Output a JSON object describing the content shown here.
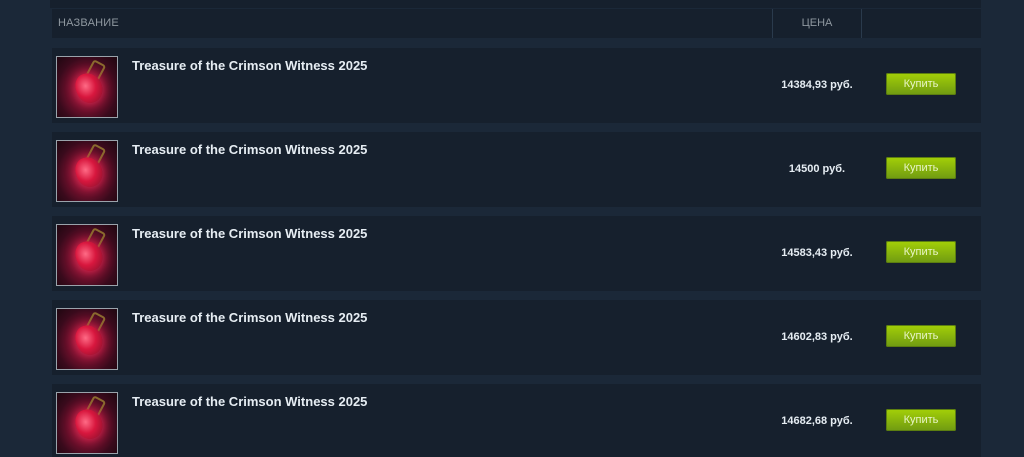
{
  "table": {
    "header": {
      "name_label": "НАЗВАНИЕ",
      "price_label": "ЦЕНА"
    },
    "rows": [
      {
        "name": "Treasure of the Crimson Witness 2025",
        "price": "14384,93 руб.",
        "buy_label": "Купить"
      },
      {
        "name": "Treasure of the Crimson Witness 2025",
        "price": "14500 руб.",
        "buy_label": "Купить"
      },
      {
        "name": "Treasure of the Crimson Witness 2025",
        "price": "14583,43 руб.",
        "buy_label": "Купить"
      },
      {
        "name": "Treasure of the Crimson Witness 2025",
        "price": "14602,83 руб.",
        "buy_label": "Купить"
      },
      {
        "name": "Treasure of the Crimson Witness 2025",
        "price": "14682,68 руб.",
        "buy_label": "Купить"
      }
    ]
  },
  "colors": {
    "background": "#1b2838",
    "row_background": "#16202d",
    "buy_button": "#a4d007"
  }
}
